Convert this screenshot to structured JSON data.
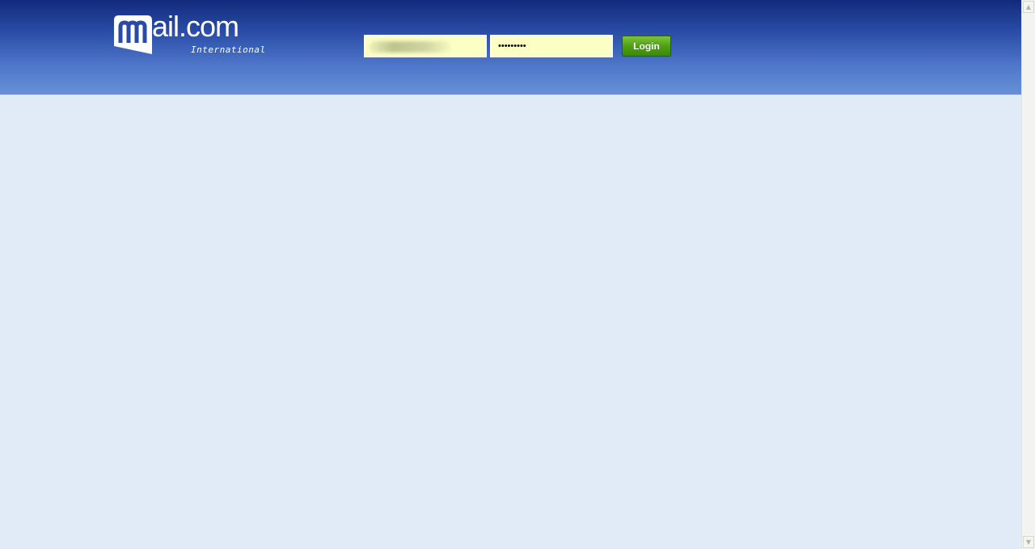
{
  "logo": {
    "brand_text": "ail.com",
    "sub_text": "International"
  },
  "login": {
    "username_value": "",
    "password_value": "•••••••••",
    "button_label": "Login"
  },
  "scrollbar": {
    "up_icon": "▲",
    "down_icon": "▼"
  },
  "colors": {
    "header_top": "#122a7c",
    "header_bottom": "#6790d8",
    "page_background": "#e1ebf8",
    "input_background": "#fbffc4",
    "button_green": "#4fa014"
  }
}
